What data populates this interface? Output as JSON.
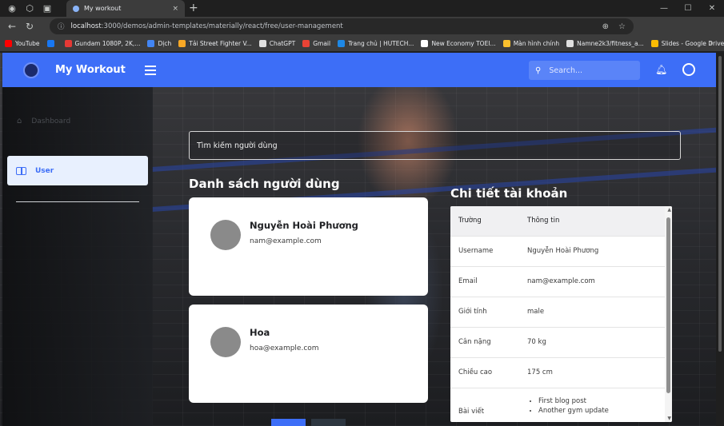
{
  "browser": {
    "tab_title": "My workout",
    "tab_close": "×",
    "new_tab": "+",
    "url_host": "localhost",
    "url_path": ":3000/demos/admin-templates/materially/react/free/user-management",
    "bookmarks": [
      {
        "label": "YouTube",
        "color": "#ff0000"
      },
      {
        "label": "",
        "color": "#1877f2"
      },
      {
        "label": "Gundam 1080P, 2K,...",
        "color": "#e53935"
      },
      {
        "label": "Dịch",
        "color": "#4285f4"
      },
      {
        "label": "Tải Street Fighter V...",
        "color": "#f9a825"
      },
      {
        "label": "ChatGPT",
        "color": "#e0e0e0"
      },
      {
        "label": "Gmail",
        "color": "#ea4335"
      },
      {
        "label": "Trang chủ | HUTECH...",
        "color": "#1e88e5"
      },
      {
        "label": "New Economy TOEI...",
        "color": "#ffffff"
      },
      {
        "label": "Màn hình chính",
        "color": "#fbc02d"
      },
      {
        "label": "Namne2k3/fitness_a...",
        "color": "#e0e0e0"
      },
      {
        "label": "Slides - Google Drive",
        "color": "#fbbc04"
      }
    ]
  },
  "app": {
    "brand": "My Workout",
    "search_placeholder": "Search...",
    "accent": "#3d6ef7"
  },
  "sidebar": {
    "dashboard_label": "Dashboard",
    "user_label": "User"
  },
  "main": {
    "search_placeholder": "Tìm kiếm người dùng",
    "list_heading": "Danh sách người dùng",
    "detail_heading": "Chi tiết tài khoản",
    "users": [
      {
        "name": "Nguyễn Hoài Phương",
        "email": "nam@example.com"
      },
      {
        "name": "Hoa",
        "email": "hoa@example.com"
      }
    ],
    "detail": {
      "col_field": "Trường",
      "col_info": "Thông tin",
      "rows": [
        {
          "field": "Username",
          "value": "Nguyễn Hoài Phương"
        },
        {
          "field": "Email",
          "value": "nam@example.com"
        },
        {
          "field": "Giới tính",
          "value": "male"
        },
        {
          "field": "Cân nặng",
          "value": "70 kg"
        },
        {
          "field": "Chiều cao",
          "value": "175 cm"
        }
      ],
      "posts_field": "Bài viết",
      "posts": [
        "First blog post",
        "Another gym update"
      ]
    }
  }
}
